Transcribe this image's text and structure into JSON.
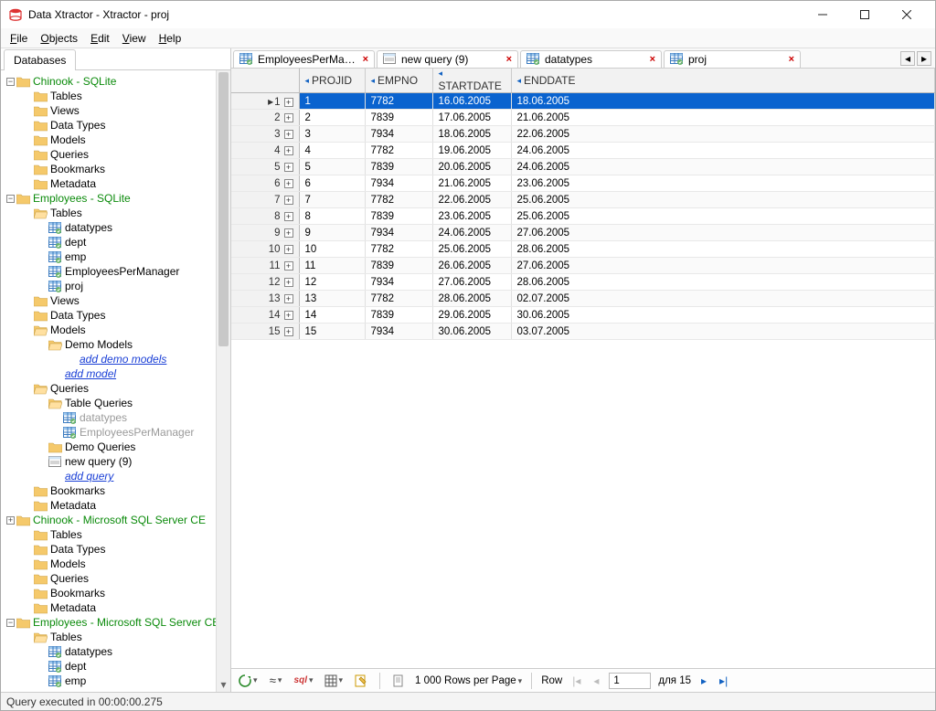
{
  "window": {
    "title": "Data Xtractor - Xtractor - proj"
  },
  "menu": {
    "file": "File",
    "objects": "Objects",
    "edit": "Edit",
    "view": "View",
    "help": "Help"
  },
  "sidebar": {
    "tab": "Databases",
    "nodes": {
      "db1": "Chinook - SQLite",
      "db1_tables": "Tables",
      "db1_views": "Views",
      "db1_datatypes": "Data Types",
      "db1_models": "Models",
      "db1_queries": "Queries",
      "db1_bookmarks": "Bookmarks",
      "db1_metadata": "Metadata",
      "db2": "Employees - SQLite",
      "db2_tables": "Tables",
      "db2_t_datatypes": "datatypes",
      "db2_t_dept": "dept",
      "db2_t_emp": "emp",
      "db2_t_epm": "EmployeesPerManager",
      "db2_t_proj": "proj",
      "db2_views": "Views",
      "db2_datatypes": "Data Types",
      "db2_models": "Models",
      "db2_demomodels": "Demo Models",
      "db2_adddemomodels": "add demo models",
      "db2_addmodel": "add model",
      "db2_queries": "Queries",
      "db2_tablequeries": "Table Queries",
      "db2_tq_datatypes": "datatypes",
      "db2_tq_epm": "EmployeesPerManager",
      "db2_demoqueries": "Demo Queries",
      "db2_newquery": "new query (9)",
      "db2_addquery": "add query",
      "db2_bookmarks": "Bookmarks",
      "db2_metadata": "Metadata",
      "db3": "Chinook - Microsoft SQL Server CE",
      "db3_tables": "Tables",
      "db3_datatypes": "Data Types",
      "db3_models": "Models",
      "db3_queries": "Queries",
      "db3_bookmarks": "Bookmarks",
      "db3_metadata": "Metadata",
      "db4": "Employees - Microsoft SQL Server CE",
      "db4_tables": "Tables",
      "db4_t_datatypes": "datatypes",
      "db4_t_dept": "dept",
      "db4_t_emp": "emp"
    }
  },
  "doctabs": [
    {
      "label": "EmployeesPerManager",
      "icon": "table",
      "close": true
    },
    {
      "label": "new query (9)",
      "icon": "query",
      "close": true
    },
    {
      "label": "datatypes",
      "icon": "table",
      "close": true
    },
    {
      "label": "proj",
      "icon": "table",
      "close": true,
      "active": true
    }
  ],
  "grid": {
    "columns": [
      "PROJID",
      "EMPNO",
      "STARTDATE",
      "ENDDATE"
    ],
    "rows": [
      {
        "n": 1,
        "projid": "1",
        "empno": "7782",
        "start": "16.06.2005",
        "end": "18.06.2005",
        "selected": true
      },
      {
        "n": 2,
        "projid": "2",
        "empno": "7839",
        "start": "17.06.2005",
        "end": "21.06.2005"
      },
      {
        "n": 3,
        "projid": "3",
        "empno": "7934",
        "start": "18.06.2005",
        "end": "22.06.2005"
      },
      {
        "n": 4,
        "projid": "4",
        "empno": "7782",
        "start": "19.06.2005",
        "end": "24.06.2005"
      },
      {
        "n": 5,
        "projid": "5",
        "empno": "7839",
        "start": "20.06.2005",
        "end": "24.06.2005"
      },
      {
        "n": 6,
        "projid": "6",
        "empno": "7934",
        "start": "21.06.2005",
        "end": "23.06.2005"
      },
      {
        "n": 7,
        "projid": "7",
        "empno": "7782",
        "start": "22.06.2005",
        "end": "25.06.2005"
      },
      {
        "n": 8,
        "projid": "8",
        "empno": "7839",
        "start": "23.06.2005",
        "end": "25.06.2005"
      },
      {
        "n": 9,
        "projid": "9",
        "empno": "7934",
        "start": "24.06.2005",
        "end": "27.06.2005"
      },
      {
        "n": 10,
        "projid": "10",
        "empno": "7782",
        "start": "25.06.2005",
        "end": "28.06.2005"
      },
      {
        "n": 11,
        "projid": "11",
        "empno": "7839",
        "start": "26.06.2005",
        "end": "27.06.2005"
      },
      {
        "n": 12,
        "projid": "12",
        "empno": "7934",
        "start": "27.06.2005",
        "end": "28.06.2005"
      },
      {
        "n": 13,
        "projid": "13",
        "empno": "7782",
        "start": "28.06.2005",
        "end": "02.07.2005"
      },
      {
        "n": 14,
        "projid": "14",
        "empno": "7839",
        "start": "29.06.2005",
        "end": "30.06.2005"
      },
      {
        "n": 15,
        "projid": "15",
        "empno": "7934",
        "start": "30.06.2005",
        "end": "03.07.2005"
      }
    ]
  },
  "toolbar": {
    "rows_per_page": "1 000 Rows per Page",
    "row_label": "Row",
    "row_value": "1",
    "row_total": "для 15"
  },
  "status": {
    "text": "Query executed in 00:00:00.275"
  }
}
